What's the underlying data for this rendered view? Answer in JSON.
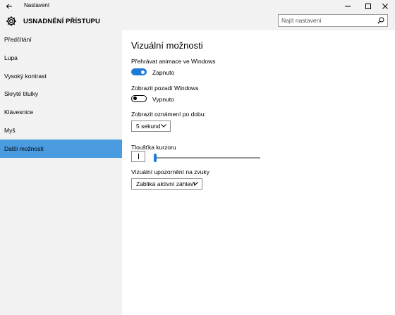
{
  "window": {
    "title": "Nastavení",
    "back_icon": "back-arrow-icon",
    "controls": [
      "minimize-icon",
      "maximize-icon",
      "close-icon"
    ]
  },
  "header": {
    "section_title": "USNADNĚNÍ PŘÍSTUPU",
    "icon": "gear-icon",
    "search": {
      "placeholder": "Najít nastavení",
      "value": "",
      "icon": "search-icon"
    }
  },
  "sidebar": {
    "items": [
      {
        "label": "Předčítání",
        "selected": false
      },
      {
        "label": "Lupa",
        "selected": false
      },
      {
        "label": "Vysoký kontrast",
        "selected": false
      },
      {
        "label": "Skryté titulky",
        "selected": false
      },
      {
        "label": "Klávesnice",
        "selected": false
      },
      {
        "label": "Myš",
        "selected": false
      },
      {
        "label": "Další možnosti",
        "selected": true
      }
    ],
    "selected_color": "#4a9be0"
  },
  "main": {
    "page_title": "Vizuální možnosti",
    "animations": {
      "label": "Přehrávat animace ve Windows",
      "state": "Zapnuto",
      "on": true
    },
    "background": {
      "label": "Zobrazit pozadí Windows",
      "state": "Vypnuto",
      "on": false
    },
    "notifications": {
      "label": "Zobrazit oznámení po dobu:",
      "selected": "5 sekund"
    },
    "cursor": {
      "label": "Tloušťka kurzoru",
      "value_fraction": 0.0
    },
    "sound_alerts": {
      "label": "Vizuální upozornění na zvuky",
      "selected": "Zabliká aktivní záhlaví"
    }
  },
  "colors": {
    "accent": "#1e7ad6",
    "panel": "#f2f2f2"
  }
}
